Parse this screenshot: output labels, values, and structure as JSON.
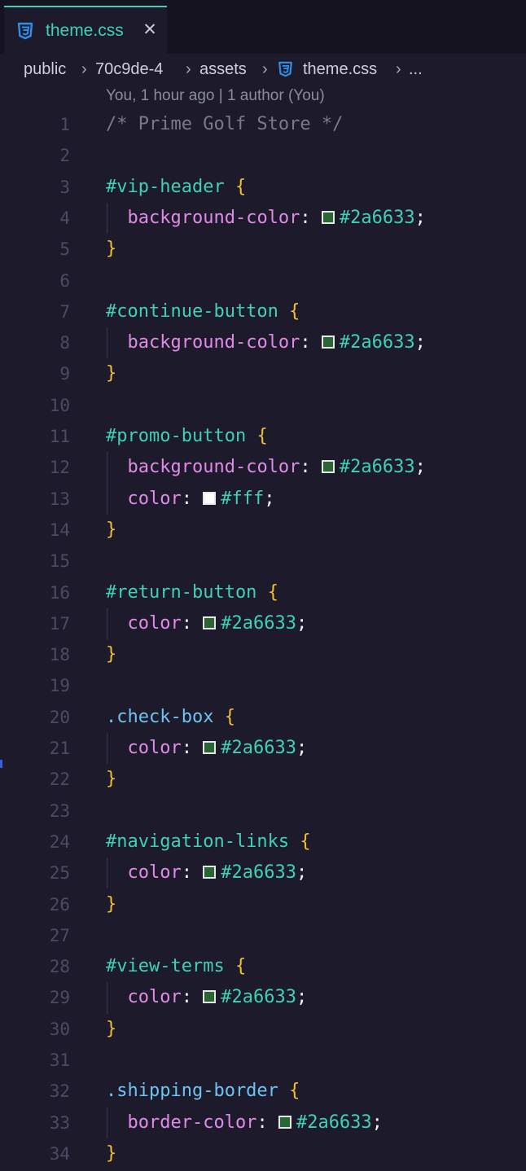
{
  "tab": {
    "label": "theme.css",
    "icon": "css-icon",
    "close_symbol": "✕"
  },
  "breadcrumb": {
    "items": [
      "public",
      "70c9de-4",
      "assets",
      "theme.css",
      "..."
    ],
    "separator": "›"
  },
  "blame": "You, 1 hour ago | 1 author (You)",
  "colors": {
    "accent": "#3fd1b6",
    "swatch_green": "#2a6633",
    "swatch_white": "#ffffff"
  },
  "editor": {
    "lines": [
      {
        "n": "1",
        "parts": [
          {
            "t": "/* Prime Golf Store */",
            "c": "comment"
          }
        ]
      },
      {
        "n": "2",
        "parts": []
      },
      {
        "n": "3",
        "parts": [
          {
            "t": "#vip-header",
            "c": "sel-id"
          },
          {
            "t": " ",
            "c": "punc"
          },
          {
            "t": "{",
            "c": "brace"
          }
        ]
      },
      {
        "n": "4",
        "indent": true,
        "parts": [
          {
            "t": "  ",
            "c": "punc"
          },
          {
            "t": "background-color",
            "c": "prop"
          },
          {
            "t": ": ",
            "c": "punc"
          },
          {
            "swatch": "#2a6633"
          },
          {
            "t": "#2a6633",
            "c": "val"
          },
          {
            "t": ";",
            "c": "punc"
          }
        ]
      },
      {
        "n": "5",
        "parts": [
          {
            "t": "}",
            "c": "brace"
          }
        ]
      },
      {
        "n": "6",
        "parts": []
      },
      {
        "n": "7",
        "parts": [
          {
            "t": "#continue-button",
            "c": "sel-id"
          },
          {
            "t": " ",
            "c": "punc"
          },
          {
            "t": "{",
            "c": "brace"
          }
        ]
      },
      {
        "n": "8",
        "indent": true,
        "parts": [
          {
            "t": "  ",
            "c": "punc"
          },
          {
            "t": "background-color",
            "c": "prop"
          },
          {
            "t": ": ",
            "c": "punc"
          },
          {
            "swatch": "#2a6633"
          },
          {
            "t": "#2a6633",
            "c": "val"
          },
          {
            "t": ";",
            "c": "punc"
          }
        ]
      },
      {
        "n": "9",
        "parts": [
          {
            "t": "}",
            "c": "brace"
          }
        ]
      },
      {
        "n": "10",
        "parts": []
      },
      {
        "n": "11",
        "parts": [
          {
            "t": "#promo-button",
            "c": "sel-id"
          },
          {
            "t": " ",
            "c": "punc"
          },
          {
            "t": "{",
            "c": "brace"
          }
        ]
      },
      {
        "n": "12",
        "indent": true,
        "parts": [
          {
            "t": "  ",
            "c": "punc"
          },
          {
            "t": "background-color",
            "c": "prop"
          },
          {
            "t": ": ",
            "c": "punc"
          },
          {
            "swatch": "#2a6633"
          },
          {
            "t": "#2a6633",
            "c": "val"
          },
          {
            "t": ";",
            "c": "punc"
          }
        ]
      },
      {
        "n": "13",
        "indent": true,
        "parts": [
          {
            "t": "  ",
            "c": "punc"
          },
          {
            "t": "color",
            "c": "prop"
          },
          {
            "t": ": ",
            "c": "punc"
          },
          {
            "swatch": "#ffffff"
          },
          {
            "t": "#fff",
            "c": "val"
          },
          {
            "t": ";",
            "c": "punc"
          }
        ]
      },
      {
        "n": "14",
        "parts": [
          {
            "t": "}",
            "c": "brace"
          }
        ]
      },
      {
        "n": "15",
        "parts": []
      },
      {
        "n": "16",
        "parts": [
          {
            "t": "#return-button",
            "c": "sel-id"
          },
          {
            "t": " ",
            "c": "punc"
          },
          {
            "t": "{",
            "c": "brace"
          }
        ]
      },
      {
        "n": "17",
        "indent": true,
        "parts": [
          {
            "t": "  ",
            "c": "punc"
          },
          {
            "t": "color",
            "c": "prop"
          },
          {
            "t": ": ",
            "c": "punc"
          },
          {
            "swatch": "#2a6633"
          },
          {
            "t": "#2a6633",
            "c": "val"
          },
          {
            "t": ";",
            "c": "punc"
          }
        ]
      },
      {
        "n": "18",
        "parts": [
          {
            "t": "}",
            "c": "brace"
          }
        ]
      },
      {
        "n": "19",
        "parts": []
      },
      {
        "n": "20",
        "parts": [
          {
            "t": ".check-box",
            "c": "sel-class"
          },
          {
            "t": " ",
            "c": "punc"
          },
          {
            "t": "{",
            "c": "brace"
          }
        ]
      },
      {
        "n": "21",
        "indent": true,
        "parts": [
          {
            "t": "  ",
            "c": "punc"
          },
          {
            "t": "color",
            "c": "prop"
          },
          {
            "t": ": ",
            "c": "punc"
          },
          {
            "swatch": "#2a6633"
          },
          {
            "t": "#2a6633",
            "c": "val"
          },
          {
            "t": ";",
            "c": "punc"
          }
        ]
      },
      {
        "n": "22",
        "parts": [
          {
            "t": "}",
            "c": "brace"
          }
        ]
      },
      {
        "n": "23",
        "parts": []
      },
      {
        "n": "24",
        "parts": [
          {
            "t": "#navigation-links",
            "c": "sel-id"
          },
          {
            "t": " ",
            "c": "punc"
          },
          {
            "t": "{",
            "c": "brace"
          }
        ]
      },
      {
        "n": "25",
        "indent": true,
        "parts": [
          {
            "t": "  ",
            "c": "punc"
          },
          {
            "t": "color",
            "c": "prop"
          },
          {
            "t": ": ",
            "c": "punc"
          },
          {
            "swatch": "#2a6633"
          },
          {
            "t": "#2a6633",
            "c": "val"
          },
          {
            "t": ";",
            "c": "punc"
          }
        ]
      },
      {
        "n": "26",
        "parts": [
          {
            "t": "}",
            "c": "brace"
          }
        ]
      },
      {
        "n": "27",
        "parts": []
      },
      {
        "n": "28",
        "parts": [
          {
            "t": "#view-terms",
            "c": "sel-id"
          },
          {
            "t": " ",
            "c": "punc"
          },
          {
            "t": "{",
            "c": "brace"
          }
        ]
      },
      {
        "n": "29",
        "indent": true,
        "parts": [
          {
            "t": "  ",
            "c": "punc"
          },
          {
            "t": "color",
            "c": "prop"
          },
          {
            "t": ": ",
            "c": "punc"
          },
          {
            "swatch": "#2a6633"
          },
          {
            "t": "#2a6633",
            "c": "val"
          },
          {
            "t": ";",
            "c": "punc"
          }
        ]
      },
      {
        "n": "30",
        "parts": [
          {
            "t": "}",
            "c": "brace"
          }
        ]
      },
      {
        "n": "31",
        "parts": []
      },
      {
        "n": "32",
        "parts": [
          {
            "t": ".shipping-border",
            "c": "sel-class"
          },
          {
            "t": " ",
            "c": "punc"
          },
          {
            "t": "{",
            "c": "brace"
          }
        ]
      },
      {
        "n": "33",
        "indent": true,
        "parts": [
          {
            "t": "  ",
            "c": "punc"
          },
          {
            "t": "border-color",
            "c": "prop"
          },
          {
            "t": ": ",
            "c": "punc"
          },
          {
            "swatch": "#2a6633"
          },
          {
            "t": "#2a6633",
            "c": "val"
          },
          {
            "t": ";",
            "c": "punc"
          }
        ]
      },
      {
        "n": "34",
        "parts": [
          {
            "t": "}",
            "c": "brace"
          }
        ]
      }
    ]
  }
}
